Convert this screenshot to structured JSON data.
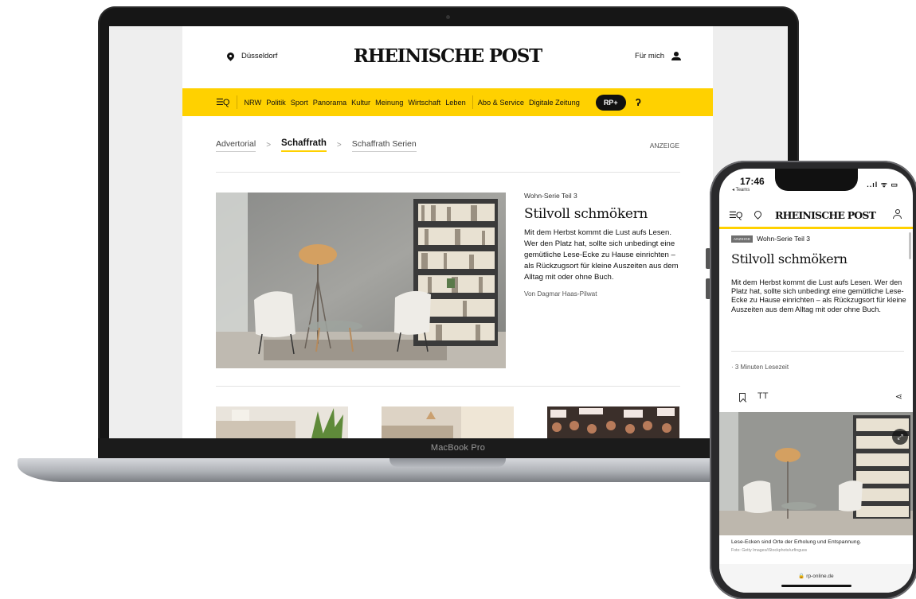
{
  "laptop": {
    "brand": "MacBook Pro",
    "site": {
      "location": "Düsseldorf",
      "logo": "RHEINISCHE POST",
      "user_label": "Für mich",
      "nav": {
        "menu_icon": "☰Q",
        "items": [
          "NRW",
          "Politik",
          "Sport",
          "Panorama",
          "Kultur",
          "Meinung",
          "Wirtschaft",
          "Leben"
        ],
        "extra_items": [
          "Abo & Service",
          "Digitale Zeitung"
        ],
        "rp_plus": "RP+",
        "extra_glyph": "ʔ"
      },
      "breadcrumbs": {
        "items": [
          "Advertorial",
          "Schaffrath",
          "Schaffrath Serien"
        ],
        "separator": ">",
        "active_index": 1
      },
      "anzeige": "ANZEIGE",
      "article": {
        "kicker": "Wohn-Serie Teil 3",
        "title": "Stilvoll schmökern",
        "teaser": "Mit dem Herbst kommt die Lust aufs Lesen. Wer den Platz hat, sollte sich unbedingt eine gemütliche Lese-Ecke zu Hause einrichten – als Rückzugsort für kleine Auszeiten aus dem Alltag mit oder ohne Buch.",
        "author": "Von Dagmar Haas-Pilwat"
      }
    }
  },
  "phone": {
    "status": {
      "time": "17:46",
      "back_app": "◂ Teams",
      "indicators": "..ıl ᯤ ▭"
    },
    "logo": "RHEINISCHE POST",
    "menu_icon": "☰Q",
    "article": {
      "badge": "ANZEIGE",
      "kicker": "Wohn-Serie Teil 3",
      "title": "Stilvoll schmökern",
      "teaser": "Mit dem Herbst kommt die Lust aufs Lesen. Wer den Platz hat, sollte sich unbedingt eine gemütliche Lese-Ecke zu Hause einrichten – als Rückzugsort für kleine Auszeiten aus dem Alltag mit oder ohne Buch.",
      "read_time": "· 3 Minuten Lesezeit",
      "text_size_icon": "TT",
      "share_icon": "⋖",
      "expand_icon": "⤢",
      "caption": "Lese-Ecken sind Orte der Erholung und Entspannung.",
      "credit": "Foto: Getty Images/iStockphoto/urfinguss"
    },
    "url": "🔒 rp-online.de"
  },
  "colors": {
    "brand_yellow": "#ffd100",
    "text_dark": "#111111",
    "device_frame": "#161616"
  }
}
